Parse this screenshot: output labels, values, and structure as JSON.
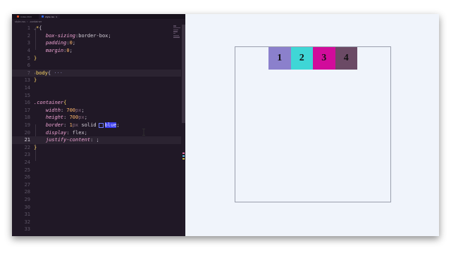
{
  "editor": {
    "tabs": [
      {
        "label": "index.html",
        "kind": "html",
        "active": false
      },
      {
        "label": "style.css",
        "kind": "css",
        "active": true
      }
    ],
    "breadcrumb": [
      "style.css",
      "›",
      ".container"
    ],
    "lines": [
      {
        "n": "1",
        "text": "*{"
      },
      {
        "n": "2",
        "text": "    box-sizing:border-box;"
      },
      {
        "n": "3",
        "text": "    padding:0;"
      },
      {
        "n": "4",
        "text": "    margin:0;"
      },
      {
        "n": "5",
        "text": "}"
      },
      {
        "n": "6",
        "text": ""
      },
      {
        "n": "7",
        "text": "body{ ···"
      },
      {
        "n": "13",
        "text": "}"
      },
      {
        "n": "14",
        "text": ""
      },
      {
        "n": "15",
        "text": ""
      },
      {
        "n": "16",
        "text": ".container{"
      },
      {
        "n": "17",
        "text": "    width: 700px;"
      },
      {
        "n": "18",
        "text": "    height: 700px;"
      },
      {
        "n": "19",
        "text": "    border: 1px solid blue;"
      },
      {
        "n": "20",
        "text": "    display: flex;"
      },
      {
        "n": "21",
        "text": "    justify-content: ;"
      },
      {
        "n": "22",
        "text": "}"
      },
      {
        "n": "23",
        "text": ""
      },
      {
        "n": "24",
        "text": ""
      },
      {
        "n": "25",
        "text": ""
      },
      {
        "n": "26",
        "text": ""
      },
      {
        "n": "27",
        "text": ""
      },
      {
        "n": "28",
        "text": ""
      },
      {
        "n": "29",
        "text": ""
      },
      {
        "n": "30",
        "text": ""
      },
      {
        "n": "31",
        "text": ""
      },
      {
        "n": "32",
        "text": ""
      },
      {
        "n": "33",
        "text": ""
      }
    ],
    "current_line": "21"
  },
  "preview": {
    "boxes": [
      {
        "label": "1",
        "color": "#8b80cc"
      },
      {
        "label": "2",
        "color": "#3fd6d6"
      },
      {
        "label": "3",
        "color": "#d10c9b"
      },
      {
        "label": "4",
        "color": "#6b4a65"
      }
    ]
  },
  "colors": {
    "editor_bg": "#201826",
    "preview_bg": "#f0f4fb",
    "container_border": "#9a9fad"
  }
}
